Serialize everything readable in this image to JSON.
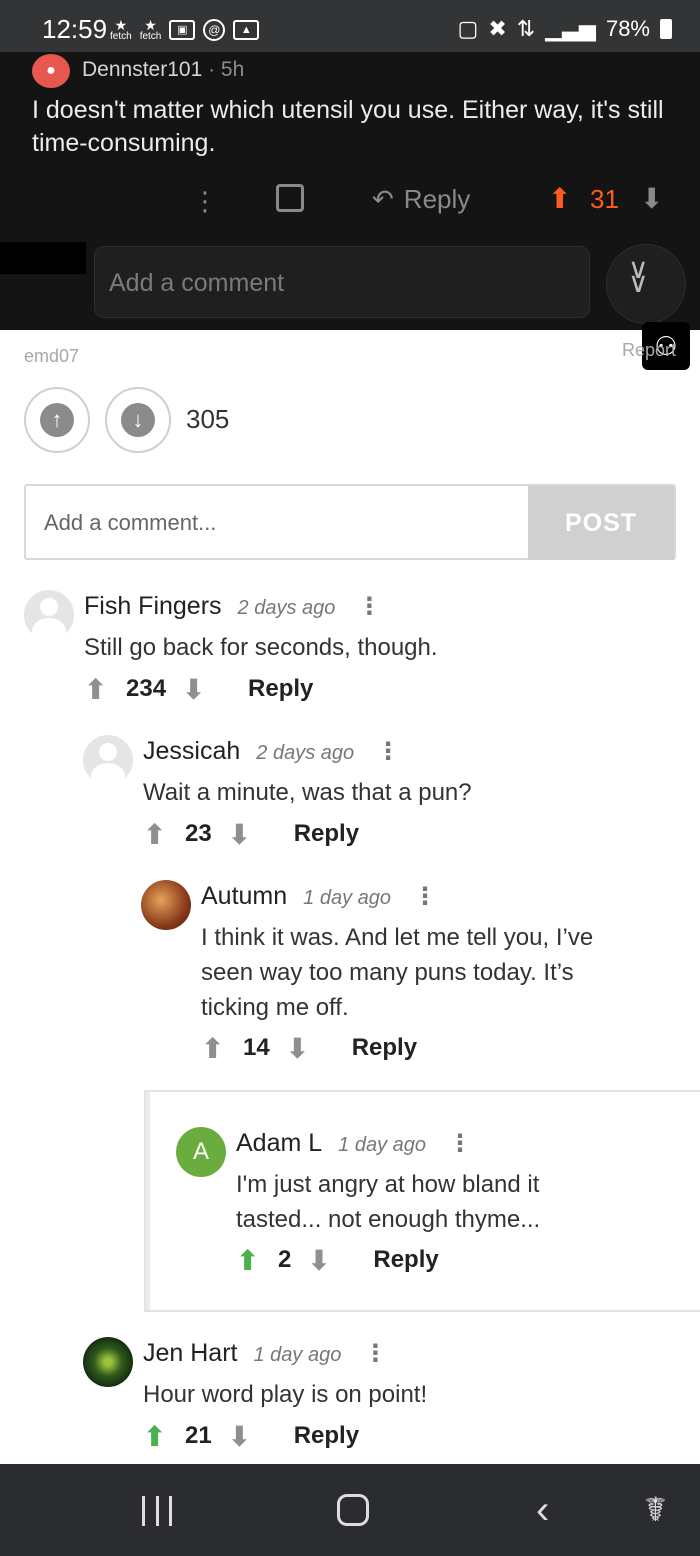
{
  "status_bar": {
    "time": "12:59",
    "fetch_label": "fetch",
    "battery": "78%"
  },
  "screenshot": {
    "username": "Dennster101",
    "age": "5h",
    "body": "I doesn't matter which utensil you use. Either way, it's still time-consuming.",
    "reply_label": "Reply",
    "score": "31",
    "add_comment_placeholder": "Add a comment"
  },
  "post": {
    "poster": "emd07",
    "report_label": "Report",
    "score": "305",
    "comment_placeholder": "Add a comment...",
    "post_button": "POST"
  },
  "comments": [
    {
      "name": "Fish Fingers",
      "time": "2 days ago",
      "text": "Still go back for seconds, though.",
      "score": "234",
      "reply": "Reply",
      "upvoted": false
    },
    {
      "name": "Jessicah",
      "time": "2 days ago",
      "text": "Wait a minute, was that a pun?",
      "score": "23",
      "reply": "Reply",
      "upvoted": false
    },
    {
      "name": "Autumn",
      "time": "1 day ago",
      "text_lines": [
        "I think it was. And let me tell you, I’ve",
        "seen way too many puns today. It’s",
        "ticking me off."
      ],
      "score": "14",
      "reply": "Reply",
      "upvoted": false
    },
    {
      "name": "Adam L",
      "avatar_letter": "A",
      "time": "1 day ago",
      "text_lines": [
        "I'm just angry at how bland it",
        "tasted... not enough thyme..."
      ],
      "score": "2",
      "reply": "Reply",
      "upvoted": true
    },
    {
      "name": "Jen Hart",
      "time": "1 day ago",
      "text": "Hour word play is on point!",
      "score": "21",
      "reply": "Reply",
      "upvoted": true
    }
  ],
  "colors": {
    "upvote_orange": "#ff5b1c",
    "upvote_green": "#4caf50",
    "dark_bg": "#141414"
  }
}
